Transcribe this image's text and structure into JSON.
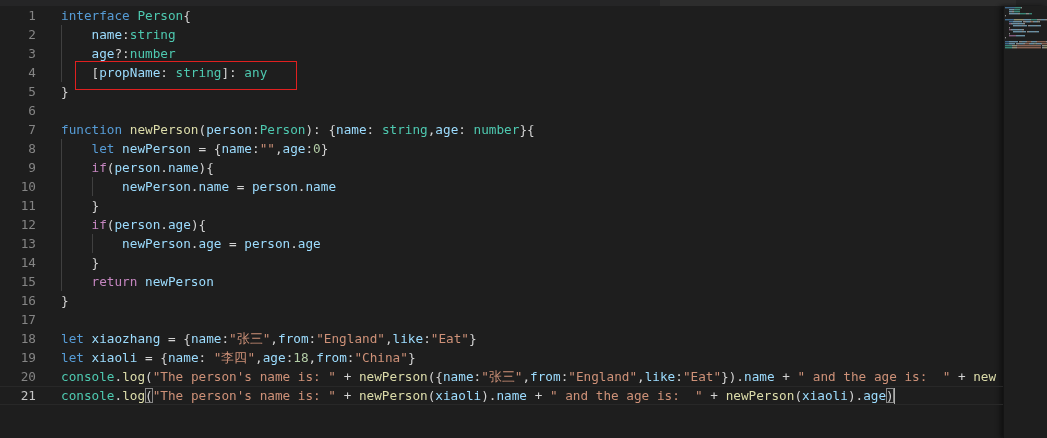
{
  "editor": {
    "lines": [
      {
        "number": "1",
        "current": false,
        "tokens": [
          {
            "kind": "keyword",
            "text": "interface "
          },
          {
            "kind": "type",
            "text": "Person"
          },
          {
            "kind": "plain",
            "text": "{"
          }
        ]
      },
      {
        "number": "2",
        "current": false,
        "tokens": [
          {
            "kind": "variable",
            "text": "    name"
          },
          {
            "kind": "plain",
            "text": ":"
          },
          {
            "kind": "type",
            "text": "string"
          }
        ]
      },
      {
        "number": "3",
        "current": false,
        "tokens": [
          {
            "kind": "variable",
            "text": "    age"
          },
          {
            "kind": "plain",
            "text": "?:"
          },
          {
            "kind": "type",
            "text": "number"
          }
        ]
      },
      {
        "number": "4",
        "current": false,
        "annotated": true,
        "tokens": [
          {
            "kind": "plain",
            "text": "    ["
          },
          {
            "kind": "variable",
            "text": "propName"
          },
          {
            "kind": "plain",
            "text": ": "
          },
          {
            "kind": "type",
            "text": "string"
          },
          {
            "kind": "plain",
            "text": "]: "
          },
          {
            "kind": "type",
            "text": "any"
          }
        ]
      },
      {
        "number": "5",
        "current": false,
        "tokens": [
          {
            "kind": "plain",
            "text": "}"
          }
        ]
      },
      {
        "number": "6",
        "current": false
      },
      {
        "number": "7",
        "current": false,
        "tokens": [
          {
            "kind": "keyword",
            "text": "function "
          },
          {
            "kind": "function",
            "text": "newPerson"
          },
          {
            "kind": "plain",
            "text": "("
          },
          {
            "kind": "variable",
            "text": "person"
          },
          {
            "kind": "plain",
            "text": ":"
          },
          {
            "kind": "type",
            "text": "Person"
          },
          {
            "kind": "plain",
            "text": "): {"
          },
          {
            "kind": "variable",
            "text": "name"
          },
          {
            "kind": "plain",
            "text": ": "
          },
          {
            "kind": "type",
            "text": "string"
          },
          {
            "kind": "plain",
            "text": ","
          },
          {
            "kind": "variable",
            "text": "age"
          },
          {
            "kind": "plain",
            "text": ": "
          },
          {
            "kind": "type",
            "text": "number"
          },
          {
            "kind": "plain",
            "text": "}{"
          }
        ]
      },
      {
        "number": "8",
        "current": false,
        "tokens": [
          {
            "kind": "keyword",
            "text": "    let "
          },
          {
            "kind": "variable",
            "text": "newPerson"
          },
          {
            "kind": "plain",
            "text": " = {"
          },
          {
            "kind": "variable",
            "text": "name"
          },
          {
            "kind": "plain",
            "text": ":"
          },
          {
            "kind": "string",
            "text": "\"\""
          },
          {
            "kind": "plain",
            "text": ","
          },
          {
            "kind": "variable",
            "text": "age"
          },
          {
            "kind": "plain",
            "text": ":"
          },
          {
            "kind": "number",
            "text": "0"
          },
          {
            "kind": "plain",
            "text": "}"
          }
        ]
      },
      {
        "number": "9",
        "current": false,
        "tokens": [
          {
            "kind": "control",
            "text": "    if"
          },
          {
            "kind": "plain",
            "text": "("
          },
          {
            "kind": "variable",
            "text": "person"
          },
          {
            "kind": "plain",
            "text": "."
          },
          {
            "kind": "variable",
            "text": "name"
          },
          {
            "kind": "plain",
            "text": "){"
          }
        ]
      },
      {
        "number": "10",
        "current": false,
        "tokens": [
          {
            "kind": "variable",
            "text": "        newPerson"
          },
          {
            "kind": "plain",
            "text": "."
          },
          {
            "kind": "variable",
            "text": "name"
          },
          {
            "kind": "plain",
            "text": " = "
          },
          {
            "kind": "variable",
            "text": "person"
          },
          {
            "kind": "plain",
            "text": "."
          },
          {
            "kind": "variable",
            "text": "name"
          }
        ]
      },
      {
        "number": "11",
        "current": false,
        "tokens": [
          {
            "kind": "plain",
            "text": "    }"
          }
        ]
      },
      {
        "number": "12",
        "current": false,
        "tokens": [
          {
            "kind": "control",
            "text": "    if"
          },
          {
            "kind": "plain",
            "text": "("
          },
          {
            "kind": "variable",
            "text": "person"
          },
          {
            "kind": "plain",
            "text": "."
          },
          {
            "kind": "variable",
            "text": "age"
          },
          {
            "kind": "plain",
            "text": "){"
          }
        ]
      },
      {
        "number": "13",
        "current": false,
        "tokens": [
          {
            "kind": "variable",
            "text": "        newPerson"
          },
          {
            "kind": "plain",
            "text": "."
          },
          {
            "kind": "variable",
            "text": "age"
          },
          {
            "kind": "plain",
            "text": " = "
          },
          {
            "kind": "variable",
            "text": "person"
          },
          {
            "kind": "plain",
            "text": "."
          },
          {
            "kind": "variable",
            "text": "age"
          }
        ]
      },
      {
        "number": "14",
        "current": false,
        "tokens": [
          {
            "kind": "plain",
            "text": "    }"
          }
        ]
      },
      {
        "number": "15",
        "current": false,
        "tokens": [
          {
            "kind": "control",
            "text": "    return "
          },
          {
            "kind": "variable",
            "text": "newPerson"
          }
        ]
      },
      {
        "number": "16",
        "current": false,
        "tokens": [
          {
            "kind": "plain",
            "text": "}"
          }
        ]
      },
      {
        "number": "17",
        "current": false
      },
      {
        "number": "18",
        "current": false,
        "tokens": [
          {
            "kind": "keyword",
            "text": "let "
          },
          {
            "kind": "variable",
            "text": "xiaozhang"
          },
          {
            "kind": "plain",
            "text": " = {"
          },
          {
            "kind": "variable",
            "text": "name"
          },
          {
            "kind": "plain",
            "text": ":"
          },
          {
            "kind": "string",
            "text": "\"张三\""
          },
          {
            "kind": "plain",
            "text": ","
          },
          {
            "kind": "variable",
            "text": "from"
          },
          {
            "kind": "plain",
            "text": ":"
          },
          {
            "kind": "string",
            "text": "\"England\""
          },
          {
            "kind": "plain",
            "text": ","
          },
          {
            "kind": "variable",
            "text": "like"
          },
          {
            "kind": "plain",
            "text": ":"
          },
          {
            "kind": "string",
            "text": "\"Eat\""
          },
          {
            "kind": "plain",
            "text": "}"
          }
        ]
      },
      {
        "number": "19",
        "current": false,
        "tokens": [
          {
            "kind": "keyword",
            "text": "let "
          },
          {
            "kind": "variable",
            "text": "xiaoli"
          },
          {
            "kind": "plain",
            "text": " = {"
          },
          {
            "kind": "variable",
            "text": "name"
          },
          {
            "kind": "plain",
            "text": ": "
          },
          {
            "kind": "string",
            "text": "\"李四\""
          },
          {
            "kind": "plain",
            "text": ","
          },
          {
            "kind": "variable",
            "text": "age"
          },
          {
            "kind": "plain",
            "text": ":"
          },
          {
            "kind": "number",
            "text": "18"
          },
          {
            "kind": "plain",
            "text": ","
          },
          {
            "kind": "variable",
            "text": "from"
          },
          {
            "kind": "plain",
            "text": ":"
          },
          {
            "kind": "string",
            "text": "\"China\""
          },
          {
            "kind": "plain",
            "text": "}"
          }
        ]
      },
      {
        "number": "20",
        "current": false,
        "tokens": [
          {
            "kind": "type",
            "text": "console"
          },
          {
            "kind": "plain",
            "text": "."
          },
          {
            "kind": "function",
            "text": "log"
          },
          {
            "kind": "plain",
            "text": "("
          },
          {
            "kind": "string",
            "text": "\"The person's name is: \""
          },
          {
            "kind": "plain",
            "text": " + "
          },
          {
            "kind": "function",
            "text": "newPerson"
          },
          {
            "kind": "plain",
            "text": "({"
          },
          {
            "kind": "variable",
            "text": "name"
          },
          {
            "kind": "plain",
            "text": ":"
          },
          {
            "kind": "string",
            "text": "\"张三\""
          },
          {
            "kind": "plain",
            "text": ","
          },
          {
            "kind": "variable",
            "text": "from"
          },
          {
            "kind": "plain",
            "text": ":"
          },
          {
            "kind": "string",
            "text": "\"England\""
          },
          {
            "kind": "plain",
            "text": ","
          },
          {
            "kind": "variable",
            "text": "like"
          },
          {
            "kind": "plain",
            "text": ":"
          },
          {
            "kind": "string",
            "text": "\"Eat\""
          },
          {
            "kind": "plain",
            "text": "})."
          },
          {
            "kind": "variable",
            "text": "name"
          },
          {
            "kind": "plain",
            "text": " + "
          },
          {
            "kind": "string",
            "text": "\" and the age is:  \""
          },
          {
            "kind": "plain",
            "text": " + "
          },
          {
            "kind": "function",
            "text": "new"
          }
        ]
      },
      {
        "number": "21",
        "current": true,
        "tokens": [
          {
            "kind": "type",
            "text": "console"
          },
          {
            "kind": "plain",
            "text": "."
          },
          {
            "kind": "function",
            "text": "log"
          },
          {
            "kind": "bracket-match",
            "text": "("
          },
          {
            "kind": "string",
            "text": "\"The person's name is: \""
          },
          {
            "kind": "plain",
            "text": " + "
          },
          {
            "kind": "function",
            "text": "newPerson"
          },
          {
            "kind": "plain",
            "text": "("
          },
          {
            "kind": "variable",
            "text": "xiaoli"
          },
          {
            "kind": "plain",
            "text": ")."
          },
          {
            "kind": "variable",
            "text": "name"
          },
          {
            "kind": "plain",
            "text": " + "
          },
          {
            "kind": "string",
            "text": "\" and the age is:  \""
          },
          {
            "kind": "plain",
            "text": " + "
          },
          {
            "kind": "function",
            "text": "newPerson"
          },
          {
            "kind": "plain",
            "text": "("
          },
          {
            "kind": "variable",
            "text": "xiaoli"
          },
          {
            "kind": "plain",
            "text": ")."
          },
          {
            "kind": "variable",
            "text": "age"
          },
          {
            "kind": "bracket-match",
            "text": ")"
          }
        ]
      }
    ]
  }
}
